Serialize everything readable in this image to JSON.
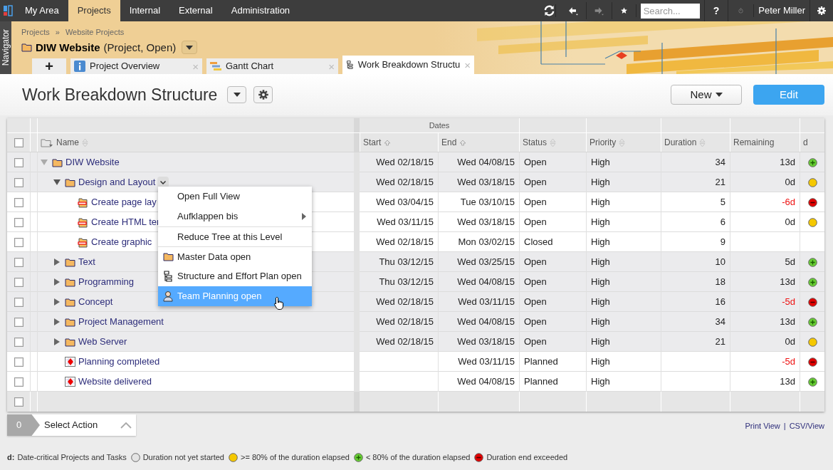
{
  "nav": {
    "tabs": [
      {
        "label": "My Area",
        "selected": false
      },
      {
        "label": "Projects",
        "selected": true
      },
      {
        "label": "Internal",
        "selected": false
      },
      {
        "label": "External",
        "selected": false
      },
      {
        "label": "Administration",
        "selected": false
      }
    ],
    "search": {
      "placeholder": "Search..."
    },
    "help": "?",
    "user": "Peter Miller"
  },
  "navigator": "Navigator",
  "header": {
    "breadcrumb": [
      "Projects",
      "»",
      "Website Projects"
    ],
    "title": "DIW Website",
    "subtitle": "(Project, Open)",
    "tabs": [
      {
        "label": "Project Overview",
        "kind": "info",
        "selected": false
      },
      {
        "label": "Gantt Chart",
        "kind": "gantt",
        "selected": false
      },
      {
        "label": "Work Breakdown Structu",
        "kind": "structure",
        "selected": true
      }
    ],
    "add": "+",
    "close": "×"
  },
  "page": {
    "title": "Work Breakdown Structure",
    "new_button": "New",
    "edit_button": "Edit"
  },
  "table": {
    "group": "Dates",
    "select_all_checked": false,
    "columns": [
      {
        "label": "Name",
        "sortable": true,
        "sorted": false
      },
      {
        "label": "Start",
        "sortable": true,
        "sorted": true
      },
      {
        "label": "End",
        "sortable": true,
        "sorted": true
      },
      {
        "label": "Status",
        "sortable": true,
        "sorted": false
      },
      {
        "label": "Priority",
        "sortable": true,
        "sorted": false
      },
      {
        "label": "Duration",
        "sortable": true,
        "sorted": false
      },
      {
        "label": "Remaining",
        "sortable": false
      },
      {
        "label": "d",
        "sortable": false
      }
    ],
    "rows": [
      {
        "name": "DIW Website",
        "kind": "summary",
        "expanded": true,
        "checked": false,
        "menu_open": false,
        "start": "Wed 02/18/15",
        "end": "Wed 04/08/15",
        "status": "Open",
        "priority": "High",
        "duration": "34",
        "remaining": "13d",
        "overdue": false,
        "color": "#66cc33",
        "children": [
          {
            "name": "Design and Layout",
            "kind": "summary",
            "expanded": true,
            "checked": false,
            "menu_open": true,
            "start": "Wed 02/18/15",
            "end": "Wed 03/18/15",
            "status": "Open",
            "priority": "High",
            "duration": "21",
            "remaining": "0d",
            "overdue": false,
            "color": "#f5c800",
            "children": [
              {
                "name": "Create page lay",
                "kind": "task",
                "checked": false,
                "menu_open": false,
                "start": "Wed 03/04/15",
                "end": "Tue 03/10/15",
                "status": "Open",
                "priority": "High",
                "duration": "5",
                "remaining": "-6d",
                "overdue": true,
                "color": "#e00000"
              },
              {
                "name": "Create HTML ter",
                "kind": "task",
                "checked": false,
                "menu_open": false,
                "start": "Wed 03/11/15",
                "end": "Wed 03/18/15",
                "status": "Open",
                "priority": "High",
                "duration": "6",
                "remaining": "0d",
                "overdue": false,
                "color": "#f5c800"
              },
              {
                "name": "Create graphic",
                "kind": "task",
                "checked": false,
                "menu_open": false,
                "start": "Wed 02/18/15",
                "end": "Mon 03/02/15",
                "status": "Closed",
                "priority": "High",
                "duration": "9"
              }
            ]
          },
          {
            "name": "Text",
            "kind": "summary",
            "expanded": false,
            "checked": false,
            "menu_open": false,
            "start": "Thu 03/12/15",
            "end": "Wed 03/25/15",
            "status": "Open",
            "priority": "High",
            "duration": "10",
            "remaining": "5d",
            "overdue": false,
            "color": "#66cc33"
          },
          {
            "name": "Programming",
            "kind": "summary",
            "expanded": false,
            "checked": false,
            "menu_open": false,
            "start": "Thu 03/12/15",
            "end": "Wed 04/08/15",
            "status": "Open",
            "priority": "High",
            "duration": "18",
            "remaining": "13d",
            "overdue": false,
            "color": "#66cc33"
          },
          {
            "name": "Concept",
            "kind": "summary",
            "expanded": false,
            "checked": false,
            "menu_open": false,
            "start": "Wed 02/18/15",
            "end": "Wed 03/11/15",
            "status": "Open",
            "priority": "High",
            "duration": "16",
            "remaining": "-5d",
            "overdue": true,
            "color": "#e00000"
          },
          {
            "name": "Project Management",
            "kind": "summary",
            "expanded": false,
            "checked": false,
            "menu_open": false,
            "start": "Wed 02/18/15",
            "end": "Wed 04/08/15",
            "status": "Open",
            "priority": "High",
            "duration": "34",
            "remaining": "13d",
            "overdue": false,
            "color": "#66cc33"
          },
          {
            "name": "Web Server",
            "kind": "summary",
            "expanded": false,
            "checked": false,
            "menu_open": false,
            "start": "Wed 02/18/15",
            "end": "Wed 03/18/15",
            "status": "Open",
            "priority": "High",
            "duration": "21",
            "remaining": "0d",
            "overdue": false,
            "color": "#f5c800"
          },
          {
            "name": "Planning completed",
            "kind": "milestone",
            "checked": false,
            "menu_open": false,
            "end": "Wed 03/11/15",
            "status": "Planned",
            "priority": "High",
            "remaining": "-5d",
            "overdue": true,
            "color": "#e00000"
          },
          {
            "name": "Website delivered",
            "kind": "milestone",
            "checked": false,
            "menu_open": false,
            "end": "Wed 04/08/15",
            "status": "Planned",
            "priority": "High",
            "remaining": "13d",
            "overdue": false,
            "color": "#66cc33"
          }
        ]
      }
    ],
    "footer_checked": false
  },
  "context_menu": [
    {
      "label": "Open Full View",
      "kind": "plain",
      "selected": false
    },
    {
      "label": "Aufklappen bis",
      "kind": "submenu",
      "selected": false
    },
    {
      "label": "Reduce Tree at this Level",
      "kind": "plain",
      "selected": false
    },
    {
      "label": "Master Data open",
      "kind": "folder",
      "selected": false
    },
    {
      "label": "Structure and Effort Plan open",
      "kind": "structure",
      "selected": false
    },
    {
      "label": "Team Planning open",
      "kind": "team",
      "selected": true
    }
  ],
  "actions": {
    "count": "0",
    "label": "Select Action"
  },
  "links": [
    "Print View",
    "|",
    "CSV/View"
  ],
  "legend": {
    "title": "d:",
    "text": "Date-critical Projects and Tasks",
    "items": [
      {
        "label": "Duration not yet started",
        "color": "#e4e4e4"
      },
      {
        "label": ">= 80% of the duration elapsed",
        "color": "#f5c800"
      },
      {
        "label": "< 80% of the duration elapsed",
        "color": "#66cc33"
      },
      {
        "label": "Duration end exceeded",
        "color": "#e00000"
      }
    ]
  }
}
